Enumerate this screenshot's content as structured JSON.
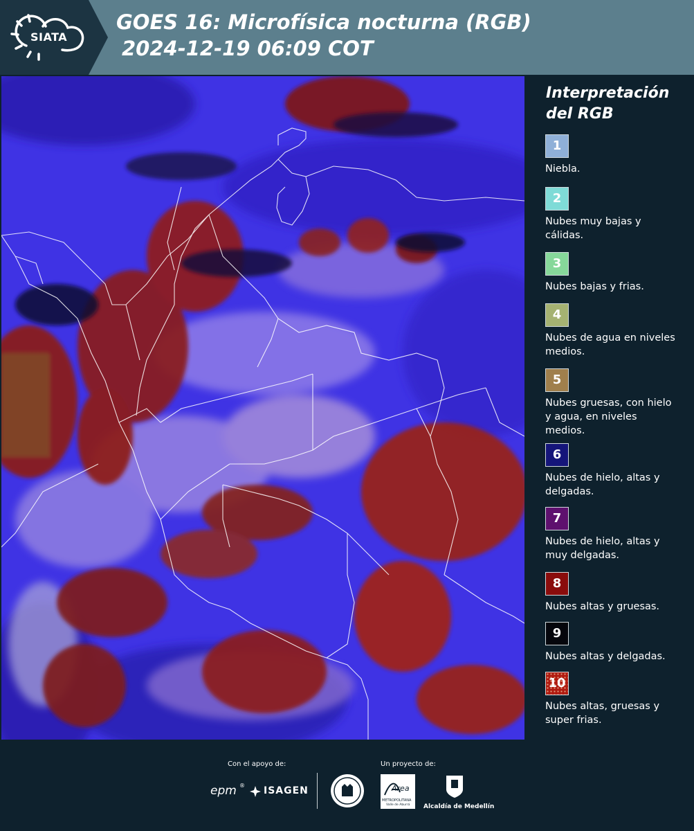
{
  "header": {
    "logo_text": "SIATA",
    "title": "GOES 16: Microfísica nocturna (RGB)",
    "subtitle": "2024-12-19 06:09 COT"
  },
  "legend": {
    "title": "Interpretación del RGB",
    "items": [
      {
        "number": "1",
        "label": "Niebla.",
        "color": "#8fb0d8"
      },
      {
        "number": "2",
        "label": "Nubes muy bajas y cálidas.",
        "color": "#7fdbd7"
      },
      {
        "number": "3",
        "label": "Nubes bajas y frias.",
        "color": "#86d89a"
      },
      {
        "number": "4",
        "label": "Nubes de agua en niveles medios.",
        "color": "#a5b272"
      },
      {
        "number": "5",
        "label": "Nubes gruesas, con hielo y agua, en niveles medios.",
        "color": "#a07f4c"
      },
      {
        "number": "6",
        "label": "Nubes de hielo, altas y delgadas.",
        "color": "#15157a"
      },
      {
        "number": "7",
        "label": "Nubes de hielo, altas y muy delgadas.",
        "color": "#5e106e"
      },
      {
        "number": "8",
        "label": "Nubes altas y gruesas.",
        "color": "#8a0c0c"
      },
      {
        "number": "9",
        "label": "Nubes altas y delgadas.",
        "color": "#05060c"
      },
      {
        "number": "10",
        "label": "Nubes altas, gruesas y super frias.",
        "color": "#b01a10"
      }
    ]
  },
  "footer": {
    "support_caption": "Con el apoyo de:",
    "project_caption": "Un proyecto de:",
    "sponsor_epm": "epm",
    "sponsor_isagen": "ISAGEN",
    "logo_area": "Área",
    "logo_area_sub": "METROPOLITANA",
    "logo_area_sub2": "Valle de Aburrá",
    "logo_alcaldia": "Alcaldía de Medellín"
  }
}
